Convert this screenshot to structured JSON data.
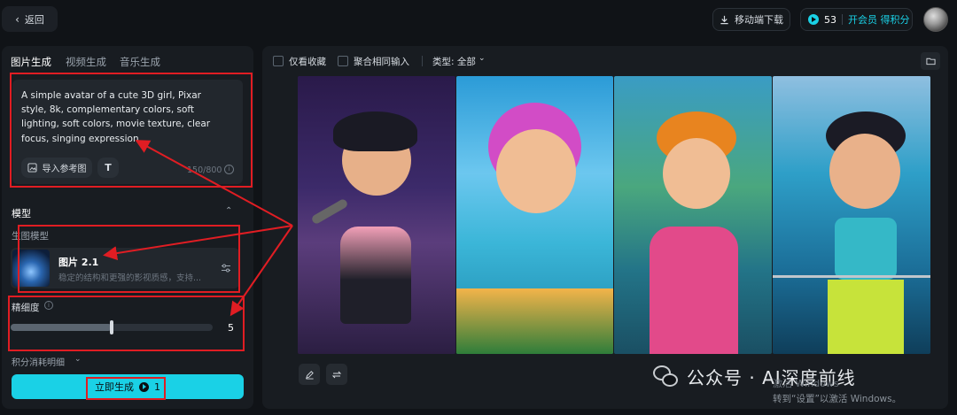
{
  "topbar": {
    "back_label": "返回",
    "download_label": "移动端下载",
    "points": "53",
    "member_label": "开会员 得积分"
  },
  "left": {
    "tabs": [
      {
        "label": "图片生成",
        "active": true
      },
      {
        "label": "视频生成",
        "active": false
      },
      {
        "label": "音乐生成",
        "active": false
      }
    ],
    "prompt": "A simple avatar of a cute 3D girl, Pixar style, 8k, complementary colors, soft lighting, soft colors, movie texture, clear focus, singing expression",
    "import_ref_label": "导入参考图",
    "char_count": "150/800",
    "model_section_label": "模型",
    "gen_model_label": "生图模型",
    "model_name": "图片 2.1",
    "model_desc": "稳定的结构和更强的影视质感，支持...",
    "precision_label": "精细度",
    "precision_value": "5",
    "precision_fraction": 0.5,
    "cost_detail_label": "积分消耗明细",
    "generate_label": "立即生成",
    "generate_cost": "1"
  },
  "toolbar": {
    "favorites_label": "仅看收藏",
    "merge_label": "聚合相同输入",
    "type_label": "类型: 全部"
  },
  "watermark": {
    "brand": "公众号 · AI深度前线",
    "activate_line1": "激活 Windows",
    "activate_line2": "转到“设置”以激活 Windows。"
  },
  "colors": {
    "accent": "#1ad1e6",
    "annotation": "#e01d23"
  }
}
